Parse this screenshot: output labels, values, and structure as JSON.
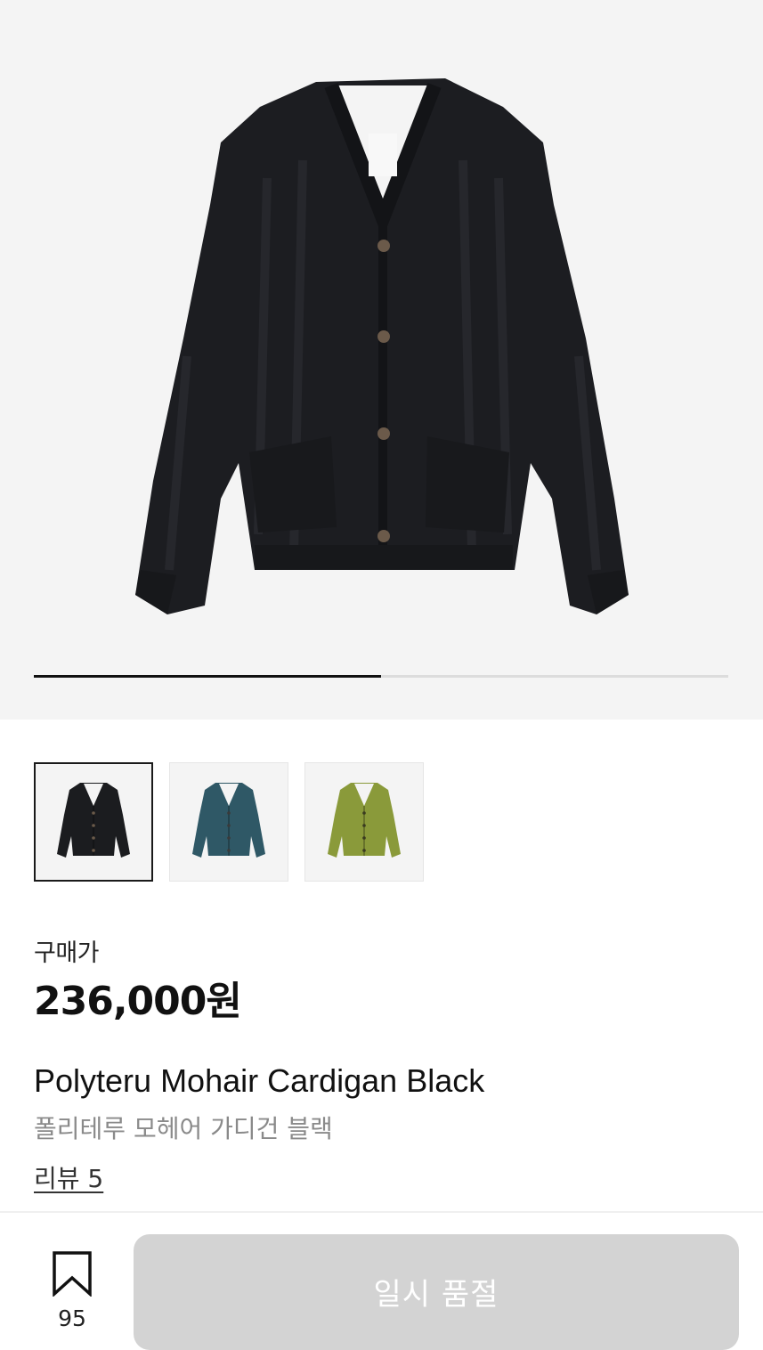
{
  "gallery": {
    "progress": 0.5,
    "thumbnails": [
      {
        "color_name": "Black",
        "fill": "#1b1c1f",
        "button": "#6b5a4a",
        "selected": true
      },
      {
        "color_name": "Blue",
        "fill": "#2f5866",
        "button": "#3a3a3a",
        "selected": false
      },
      {
        "color_name": "Olive",
        "fill": "#8a9a3a",
        "button": "#3a3a20",
        "selected": false
      }
    ]
  },
  "product": {
    "price_label": "구매가",
    "price": "236,000원",
    "name_en": "Polyteru Mohair Cardigan Black",
    "name_ko": "폴리테루 모헤어 가디건 블랙",
    "review_link": "리뷰 5"
  },
  "bottom_bar": {
    "bookmark_icon": "bookmark-outline-icon",
    "bookmark_count": "95",
    "soldout_button": "일시 품절"
  },
  "colors": {
    "hero_bg": "#f4f4f4",
    "button_disabled": "#d3d3d3"
  }
}
